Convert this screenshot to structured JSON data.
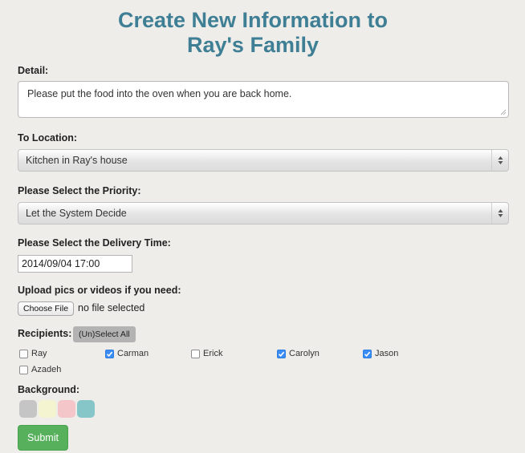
{
  "form": {
    "title_line1": "Create New Information to",
    "title_line2": "Ray's Family",
    "detail_label": "Detail:",
    "detail_value": "Please put the food into the oven when you are back home.",
    "location_label": "To Location:",
    "location_value": "Kitchen in Ray's house",
    "priority_label": "Please Select the Priority:",
    "priority_value": "Let the System Decide",
    "delivery_label": "Please Select the Delivery Time:",
    "delivery_value": "2014/09/04 17:00",
    "upload_label": "Upload pics or videos if you need:",
    "choose_file_label": "Choose File",
    "file_status": "no file selected",
    "recipients_label": "Recipients:",
    "select_all_label": "(Un)Select All",
    "recipients": [
      {
        "name": "Ray",
        "checked": false
      },
      {
        "name": "Carman",
        "checked": true
      },
      {
        "name": "Erick",
        "checked": false
      },
      {
        "name": "Carolyn",
        "checked": true
      },
      {
        "name": "Jason",
        "checked": true
      },
      {
        "name": "Azadeh",
        "checked": false
      }
    ],
    "background_label": "Background:",
    "background_colors": [
      "#c5c5c5",
      "#f5f4d0",
      "#f4c6c9",
      "#86c6c9"
    ],
    "submit_label": "Submit"
  },
  "colors": {
    "title": "#3f7f95",
    "checkbox_checked": "#3b8cf4",
    "submit": "#57b05c"
  }
}
